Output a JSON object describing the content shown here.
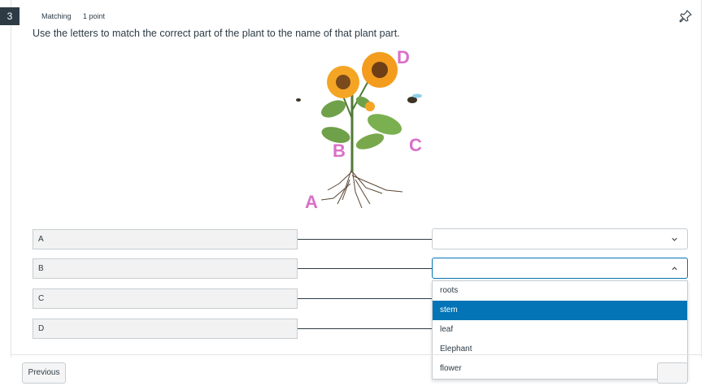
{
  "question": {
    "number": "3",
    "type": "Matching",
    "points": "1 point",
    "prompt": "Use the letters to match the correct part of the plant to the name of that plant part."
  },
  "image": {
    "labels": [
      "A",
      "B",
      "C",
      "D"
    ],
    "label_color": "#d970c8"
  },
  "matches": [
    {
      "left": "A",
      "selected": ""
    },
    {
      "left": "B",
      "selected": ""
    },
    {
      "left": "C",
      "selected": ""
    },
    {
      "left": "D",
      "selected": ""
    }
  ],
  "dropdown": {
    "options": [
      "roots",
      "stem",
      "leaf",
      "Elephant",
      "flower"
    ],
    "highlighted": "stem"
  },
  "nav": {
    "previous_label": "Previous"
  },
  "colors": {
    "accent": "#0374b5",
    "text": "#2d3b45",
    "border": "#c7cdd1"
  },
  "icons": [
    "pin-icon",
    "chevron-down-icon",
    "chevron-up-icon"
  ]
}
